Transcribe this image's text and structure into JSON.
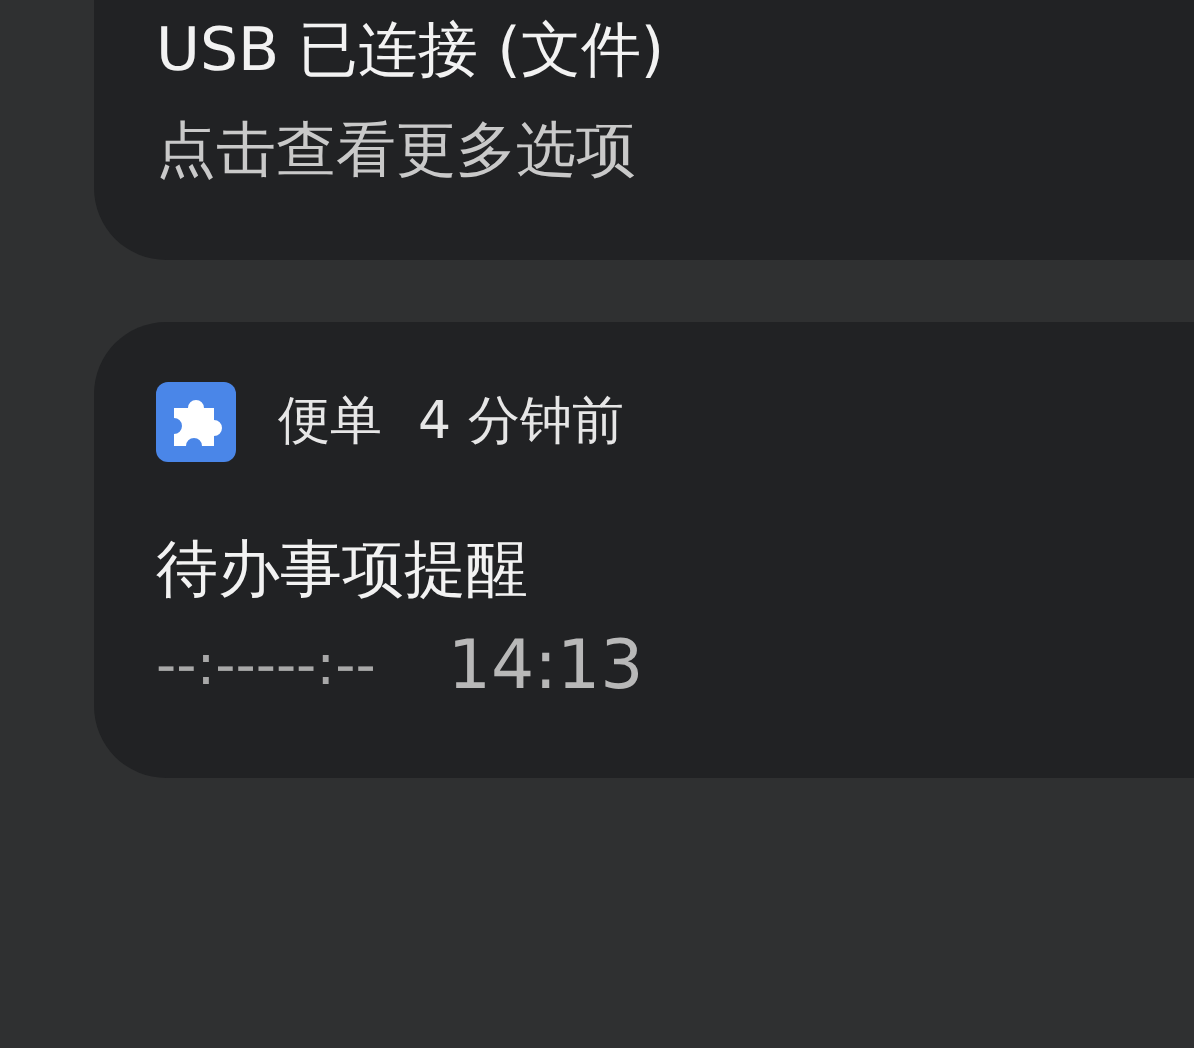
{
  "notifications": [
    {
      "kind": "system",
      "title": "USB 已连接 (文件)",
      "subtitle": "点击查看更多选项"
    },
    {
      "kind": "app",
      "app_name": "便单",
      "time": "4 分钟前",
      "title": "待办事项提醒",
      "line_start": "--:-----:--",
      "line_end": "14:13"
    }
  ]
}
